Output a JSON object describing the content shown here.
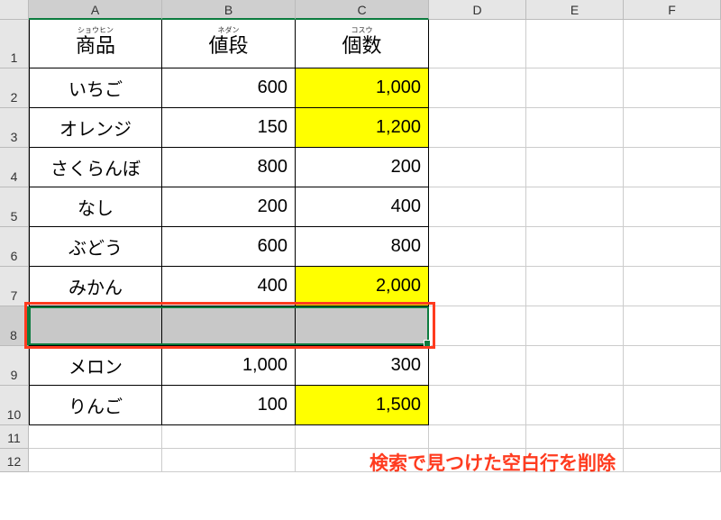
{
  "columns": [
    {
      "letter": "A",
      "width": 148,
      "selected": true
    },
    {
      "letter": "B",
      "width": 148,
      "selected": true
    },
    {
      "letter": "C",
      "width": 148,
      "selected": true
    },
    {
      "letter": "D",
      "width": 108,
      "selected": false
    },
    {
      "letter": "E",
      "width": 108,
      "selected": false
    },
    {
      "letter": "F",
      "width": 108,
      "selected": false
    }
  ],
  "rows": [
    {
      "num": "1",
      "height": 54,
      "selected": false
    },
    {
      "num": "2",
      "height": 44,
      "selected": false
    },
    {
      "num": "3",
      "height": 44,
      "selected": false
    },
    {
      "num": "4",
      "height": 44,
      "selected": false
    },
    {
      "num": "5",
      "height": 44,
      "selected": false
    },
    {
      "num": "6",
      "height": 44,
      "selected": false
    },
    {
      "num": "7",
      "height": 44,
      "selected": false
    },
    {
      "num": "8",
      "height": 44,
      "selected": true
    },
    {
      "num": "9",
      "height": 44,
      "selected": false
    },
    {
      "num": "10",
      "height": 44,
      "selected": false
    },
    {
      "num": "11",
      "height": 26,
      "selected": false
    },
    {
      "num": "12",
      "height": 26,
      "selected": false
    }
  ],
  "headers": {
    "a": {
      "ruby": "ショウヒン",
      "label": "商品"
    },
    "b": {
      "ruby": "ネダン",
      "label": "値段"
    },
    "c": {
      "ruby": "コスウ",
      "label": "個数"
    }
  },
  "data": [
    {
      "product": "いちご",
      "price": "600",
      "qty": "1,000",
      "qty_hl": true
    },
    {
      "product": "オレンジ",
      "price": "150",
      "qty": "1,200",
      "qty_hl": true
    },
    {
      "product": "さくらんぼ",
      "price": "800",
      "qty": "200",
      "qty_hl": false
    },
    {
      "product": "なし",
      "price": "200",
      "qty": "400",
      "qty_hl": false
    },
    {
      "product": "ぶどう",
      "price": "600",
      "qty": "800",
      "qty_hl": false
    },
    {
      "product": "みかん",
      "price": "400",
      "qty": "2,000",
      "qty_hl": true
    },
    {
      "product": "",
      "price": "",
      "qty": "",
      "qty_hl": false,
      "blank": true
    },
    {
      "product": "メロン",
      "price": "1,000",
      "qty": "300",
      "qty_hl": false
    },
    {
      "product": "りんご",
      "price": "100",
      "qty": "1,500",
      "qty_hl": true
    }
  ],
  "annotation": "検索で見つけた空白行を削除"
}
